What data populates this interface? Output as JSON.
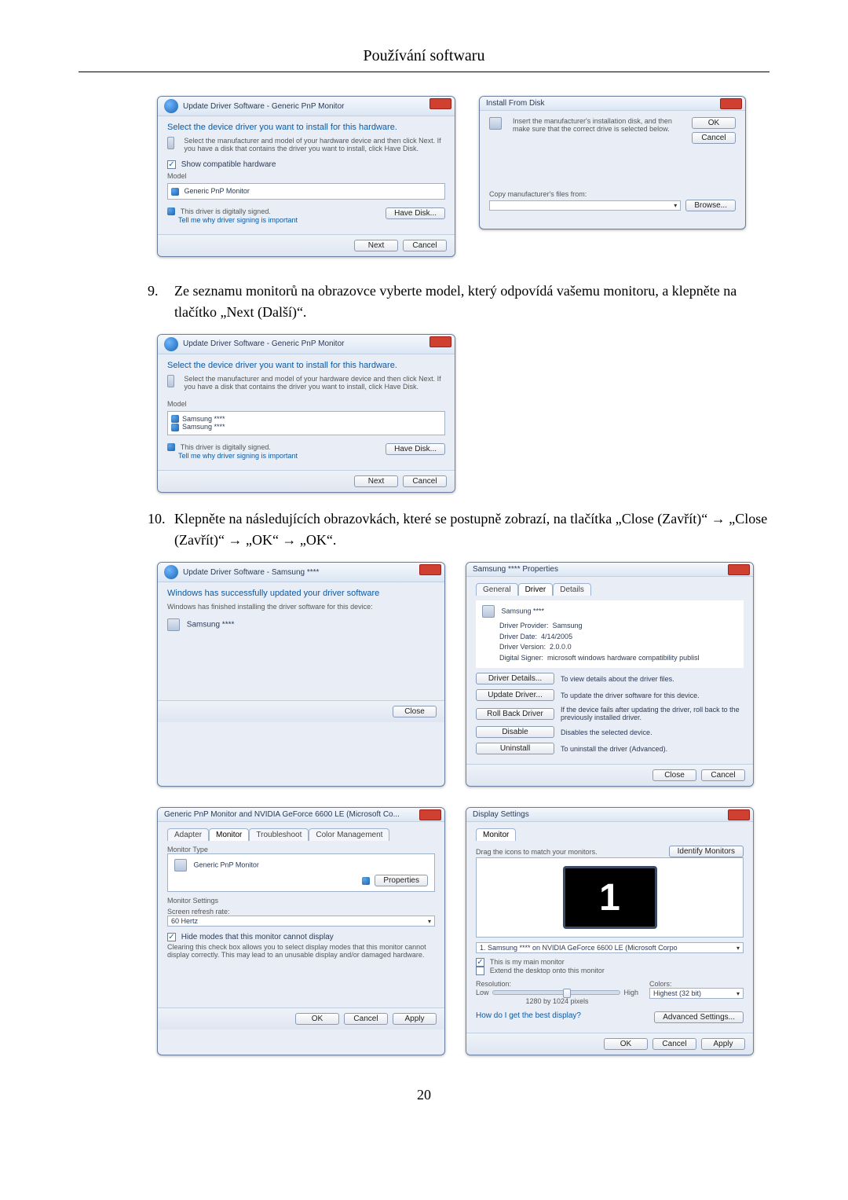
{
  "header": {
    "title": "Používání softwaru"
  },
  "winA": {
    "title": "Update Driver Software - Generic PnP Monitor",
    "heading": "Select the device driver you want to install for this hardware.",
    "subtext": "Select the manufacturer and model of your hardware device and then click Next. If you have a disk that contains the driver you want to install, click Have Disk.",
    "compat_label": "Show compatible hardware",
    "model_header": "Model",
    "model_entry": "Generic PnP Monitor",
    "signed": "This driver is digitally signed.",
    "signed_link": "Tell me why driver signing is important",
    "havedisk": "Have Disk...",
    "next": "Next",
    "cancel": "Cancel"
  },
  "winB": {
    "title": "Install From Disk",
    "instruction": "Insert the manufacturer's installation disk, and then make sure that the correct drive is selected below.",
    "ok": "OK",
    "cancel": "Cancel",
    "copy_label": "Copy manufacturer's files from:",
    "browse": "Browse..."
  },
  "step9": {
    "num": "9.",
    "text": "Ze seznamu monitorů na obrazovce vyberte model, který odpovídá vašemu monitoru, a klepněte na tlačítko „Next (Další)“."
  },
  "winC": {
    "title": "Update Driver Software - Generic PnP Monitor",
    "heading": "Select the device driver you want to install for this hardware.",
    "subtext": "Select the manufacturer and model of your hardware device and then click Next. If you have a disk that contains the driver you want to install, click Have Disk.",
    "model_header": "Model",
    "model_a": "Samsung ****",
    "model_b": "Samsung ****",
    "signed": "This driver is digitally signed.",
    "signed_link": "Tell me why driver signing is important",
    "havedisk": "Have Disk...",
    "next": "Next",
    "cancel": "Cancel"
  },
  "step10": {
    "num": "10.",
    "text": "Klepněte na následujících obrazovkách, které se postupně zobrazí, na tlačítka „Close (Zavřít)“ → „Close (Zavřít)“ → „OK“ → „OK“."
  },
  "winD": {
    "title": "Update Driver Software - Samsung ****",
    "heading": "Windows has successfully updated your driver software",
    "subtext": "Windows has finished installing the driver software for this device:",
    "device": "Samsung ****",
    "close": "Close"
  },
  "winE": {
    "title": "Samsung **** Properties",
    "tabs": {
      "general": "General",
      "driver": "Driver",
      "details": "Details"
    },
    "device": "Samsung ****",
    "prov_lbl": "Driver Provider:",
    "prov_val": "Samsung",
    "date_lbl": "Driver Date:",
    "date_val": "4/14/2005",
    "ver_lbl": "Driver Version:",
    "ver_val": "2.0.0.0",
    "sig_lbl": "Digital Signer:",
    "sig_val": "microsoft windows hardware compatibility publisl",
    "btn_details": "Driver Details...",
    "btn_update": "Update Driver...",
    "btn_rollback": "Roll Back Driver",
    "btn_disable": "Disable",
    "btn_uninstall": "Uninstall",
    "desc_details": "To view details about the driver files.",
    "desc_update": "To update the driver software for this device.",
    "desc_rollback": "If the device fails after updating the driver, roll back to the previously installed driver.",
    "desc_disable": "Disables the selected device.",
    "desc_uninstall": "To uninstall the driver (Advanced).",
    "close": "Close",
    "cancel": "Cancel"
  },
  "winF": {
    "title": "Generic PnP Monitor and NVIDIA GeForce 6600 LE (Microsoft Co...",
    "tabs": {
      "adapter": "Adapter",
      "monitor": "Monitor",
      "troubleshoot": "Troubleshoot",
      "color": "Color Management"
    },
    "sec_type": "Monitor Type",
    "type_value": "Generic PnP Monitor",
    "btn_props": "Properties",
    "sec_settings": "Monitor Settings",
    "refresh_lbl": "Screen refresh rate:",
    "refresh_val": "60 Hertz",
    "hide_lbl": "Hide modes that this monitor cannot display",
    "hide_desc": "Clearing this check box allows you to select display modes that this monitor cannot display correctly. This may lead to an unusable display and/or damaged hardware.",
    "ok": "OK",
    "cancel": "Cancel",
    "apply": "Apply"
  },
  "winG": {
    "title": "Display Settings",
    "tab": "Monitor",
    "drag_lbl": "Drag the icons to match your monitors.",
    "identify": "Identify Monitors",
    "mon_one": "1",
    "mon_select": "1. Samsung **** on NVIDIA GeForce 6600 LE (Microsoft Corpo",
    "main_lbl": "This is my main monitor",
    "extend_lbl": "Extend the desktop onto this monitor",
    "res_lbl": "Resolution:",
    "low": "Low",
    "high": "High",
    "res_val": "1280 by 1024 pixels",
    "colors_lbl": "Colors:",
    "colors_val": "Highest (32 bit)",
    "bestdisp": "How do I get the best display?",
    "adv": "Advanced Settings...",
    "ok": "OK",
    "cancel": "Cancel",
    "apply": "Apply"
  },
  "pagenum": "20"
}
